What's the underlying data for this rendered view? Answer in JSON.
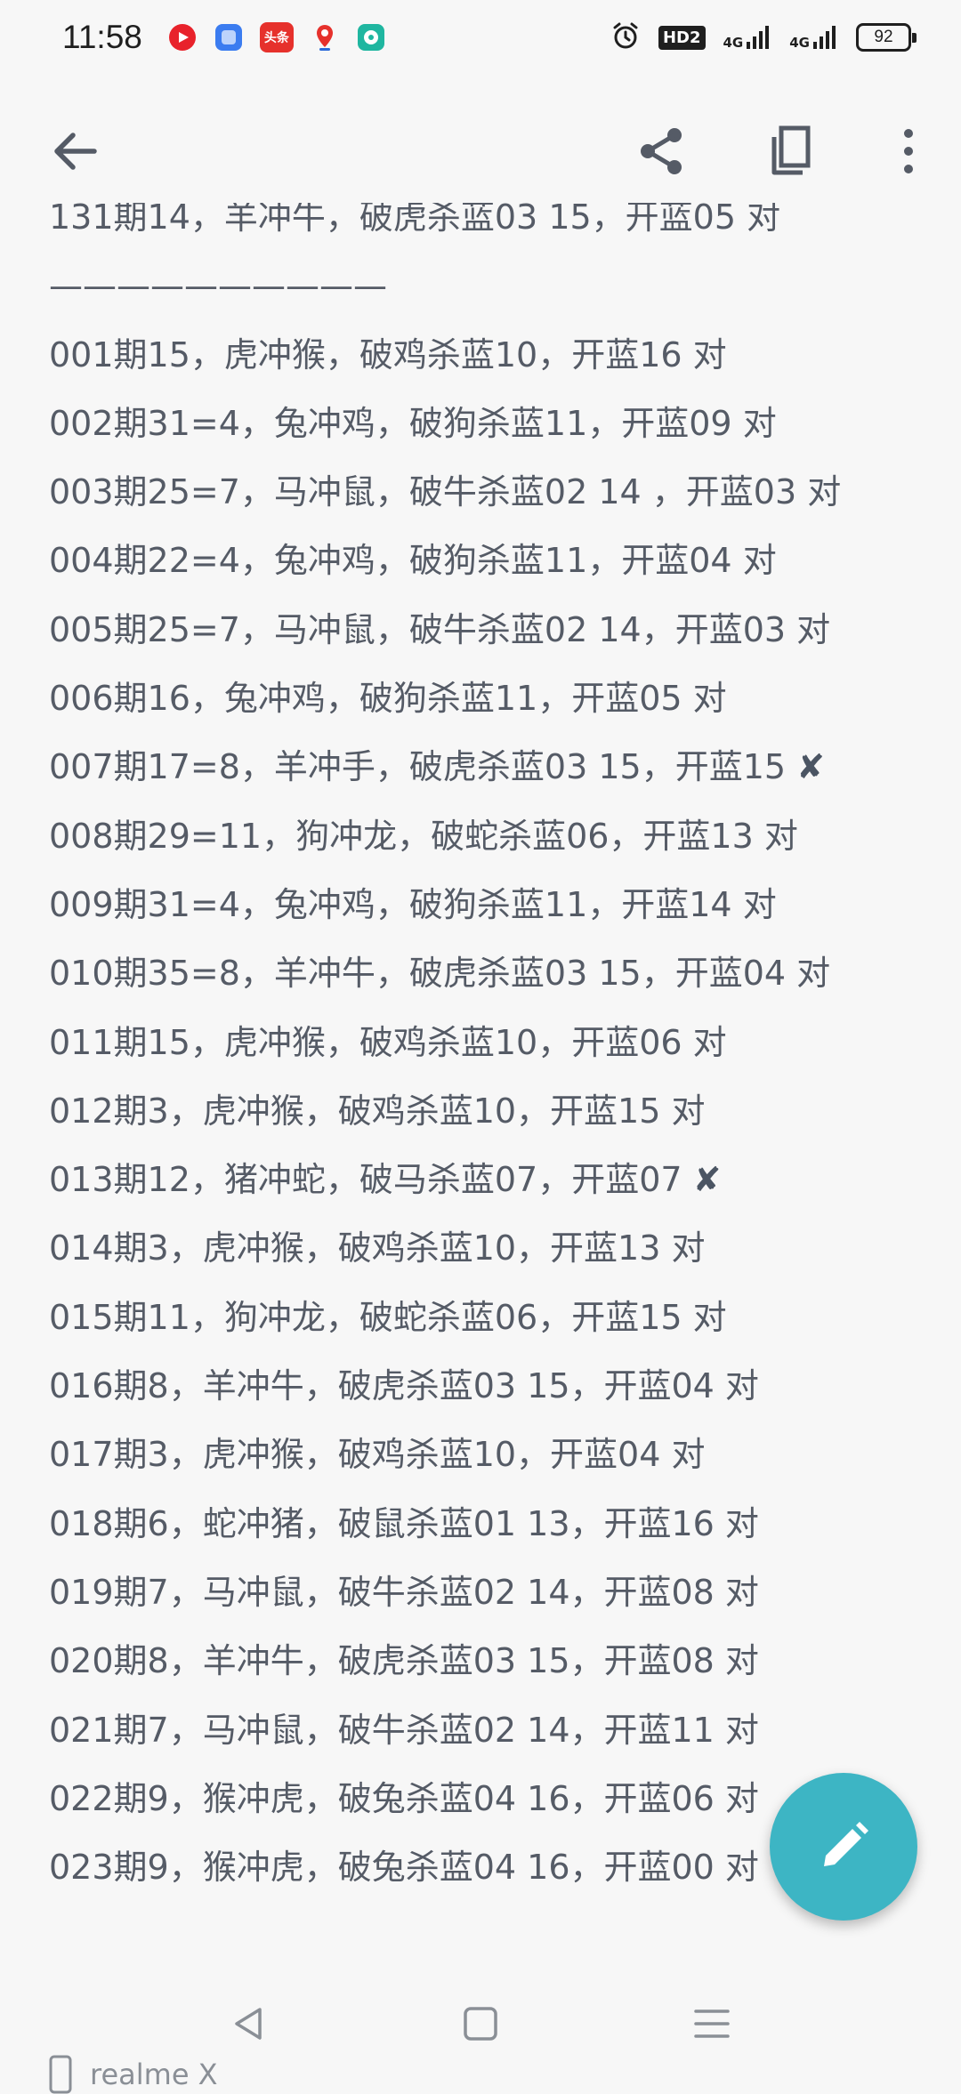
{
  "status_bar": {
    "time": "11:58",
    "hd_label": "HD2",
    "network_1": "4G",
    "network_2": "4G",
    "battery": "92"
  },
  "notification_icons": [
    {
      "name": "video-app-icon",
      "color": "#e8222b"
    },
    {
      "name": "square-app-icon",
      "color": "#3b7cf0"
    },
    {
      "name": "toutiao-icon",
      "color": "#e6312c",
      "text": "头条"
    },
    {
      "name": "map-pin-icon",
      "color": "#e6312c"
    },
    {
      "name": "chat-app-icon",
      "color": "#1fb6a0"
    }
  ],
  "toolbar": {
    "back": "back-arrow-icon",
    "share": "share-icon",
    "copy": "copy-icon",
    "more": "more-vert-icon"
  },
  "partial_top_line": "131期14，羊冲牛，破虎杀蓝03 15，开蓝05 对",
  "separator": "——————————",
  "entries": [
    {
      "text": "001期15，虎冲猴，破鸡杀蓝10，开蓝16 对",
      "mark": ""
    },
    {
      "text": "002期31=4，兔冲鸡，破狗杀蓝11，开蓝09 对",
      "mark": ""
    },
    {
      "text": "003期25=7，马冲鼠，破牛杀蓝02 14 ，开蓝03 对",
      "mark": ""
    },
    {
      "text": "004期22=4，兔冲鸡，破狗杀蓝11，开蓝04 对",
      "mark": ""
    },
    {
      "text": "005期25=7，马冲鼠，破牛杀蓝02 14，开蓝03 对",
      "mark": ""
    },
    {
      "text": "006期16，兔冲鸡，破狗杀蓝11，开蓝05 对",
      "mark": ""
    },
    {
      "text": "007期17=8，羊冲手，破虎杀蓝03 15，开蓝15 ",
      "mark": "✘"
    },
    {
      "text": "008期29=11，狗冲龙，破蛇杀蓝06，开蓝13 对",
      "mark": ""
    },
    {
      "text": "009期31=4，兔冲鸡，破狗杀蓝11，开蓝14 对",
      "mark": ""
    },
    {
      "text": "010期35=8，羊冲牛，破虎杀蓝03 15，开蓝04 对",
      "mark": ""
    },
    {
      "text": "011期15，虎冲猴，破鸡杀蓝10，开蓝06 对",
      "mark": ""
    },
    {
      "text": "012期3，虎冲猴，破鸡杀蓝10，开蓝15 对",
      "mark": ""
    },
    {
      "text": "013期12，猪冲蛇，破马杀蓝07，开蓝07 ",
      "mark": "✘"
    },
    {
      "text": "014期3，虎冲猴，破鸡杀蓝10，开蓝13 对",
      "mark": ""
    },
    {
      "text": "015期11，狗冲龙，破蛇杀蓝06，开蓝15 对",
      "mark": ""
    },
    {
      "text": "016期8，羊冲牛，破虎杀蓝03 15，开蓝04 对",
      "mark": ""
    },
    {
      "text": "017期3，虎冲猴，破鸡杀蓝10，开蓝04 对",
      "mark": ""
    },
    {
      "text": "018期6，蛇冲猪，破鼠杀蓝01 13，开蓝16 对",
      "mark": ""
    },
    {
      "text": "019期7，马冲鼠，破牛杀蓝02 14，开蓝08 对",
      "mark": ""
    },
    {
      "text": "020期8，羊冲牛，破虎杀蓝03 15，开蓝08 对",
      "mark": ""
    },
    {
      "text": "021期7，马冲鼠，破牛杀蓝02 14，开蓝11 对",
      "mark": ""
    },
    {
      "text": "022期9，猴冲虎，破兔杀蓝04 16，开蓝06 对",
      "mark": ""
    },
    {
      "text": "023期9，猴冲虎，破兔杀蓝04 16，开蓝00 对",
      "mark": ""
    }
  ],
  "fab": {
    "icon": "edit-pencil-icon",
    "color": "#3db5c4"
  },
  "nav_bar": {
    "back": "nav-back-icon",
    "home": "nav-home-icon",
    "menu": "nav-menu-icon"
  },
  "watermark": "realme X"
}
